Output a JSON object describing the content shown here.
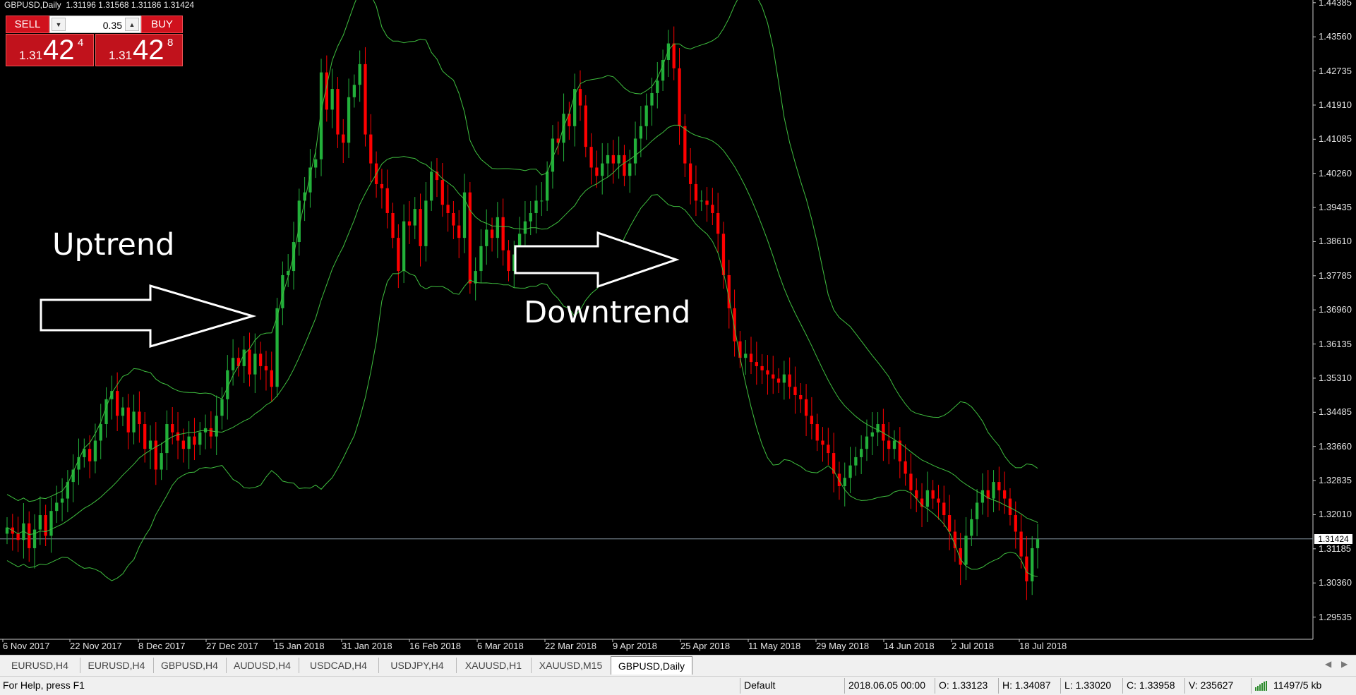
{
  "header": {
    "symbol": "GBPUSD,Daily",
    "ohlc": "1.31196 1.31568 1.31186 1.31424"
  },
  "trade_panel": {
    "sell_label": "SELL",
    "buy_label": "BUY",
    "lot_value": "0.35",
    "sell_price": {
      "prefix": "1.31",
      "big": "42",
      "sup": "4"
    },
    "buy_price": {
      "prefix": "1.31",
      "big": "42",
      "sup": "8"
    }
  },
  "annotations": {
    "uptrend": "Uptrend",
    "downtrend": "Downtrend"
  },
  "price_axis": [
    "1.44385",
    "1.43560",
    "1.42735",
    "1.41910",
    "1.41085",
    "1.40260",
    "1.39435",
    "1.38610",
    "1.37785",
    "1.36960",
    "1.36135",
    "1.35310",
    "1.34485",
    "1.33660",
    "1.32835",
    "1.32010",
    "1.31185",
    "1.30360",
    "1.29535"
  ],
  "last_price": "1.31424",
  "date_axis": [
    "6 Nov 2017",
    "22 Nov 2017",
    "8 Dec 2017",
    "27 Dec 2017",
    "15 Jan 2018",
    "31 Jan 2018",
    "16 Feb 2018",
    "6 Mar 2018",
    "22 Mar 2018",
    "9 Apr 2018",
    "25 Apr 2018",
    "11 May 2018",
    "29 May 2018",
    "14 Jun 2018",
    "2 Jul 2018",
    "18 Jul 2018"
  ],
  "tabs": [
    "EURUSD,H4",
    "EURUSD,H4",
    "GBPUSD,H4",
    "AUDUSD,H4",
    "USDCAD,H4",
    "USDJPY,H4",
    "XAUUSD,H1",
    "XAUUSD,M15",
    "GBPUSD,Daily"
  ],
  "active_tab": 8,
  "status": {
    "help": "For Help, press F1",
    "profile": "Default",
    "datetime": "2018.06.05 00:00",
    "open": "O: 1.33123",
    "high": "H: 1.34087",
    "low": "L: 1.33020",
    "close": "C: 1.33958",
    "volume": "V: 235627",
    "traffic": "11497/5 kb"
  },
  "chart_data": {
    "type": "candlestick",
    "title": "GBPUSD,Daily",
    "ylim": [
      1.2905,
      1.4445
    ],
    "bull_color": "#22b03a",
    "bear_color": "#ff0000",
    "band_color": "#3fbf3f",
    "closes": [
      1.317,
      1.3155,
      1.314,
      1.318,
      1.312,
      1.3165,
      1.32,
      1.315,
      1.321,
      1.323,
      1.324,
      1.328,
      1.331,
      1.334,
      1.336,
      1.333,
      1.338,
      1.342,
      1.348,
      1.35,
      1.344,
      1.346,
      1.34,
      1.345,
      1.342,
      1.336,
      1.338,
      1.331,
      1.335,
      1.342,
      1.34,
      1.338,
      1.336,
      1.339,
      1.337,
      1.34,
      1.341,
      1.339,
      1.344,
      1.348,
      1.355,
      1.358,
      1.356,
      1.36,
      1.354,
      1.359,
      1.356,
      1.355,
      1.351,
      1.37,
      1.378,
      1.379,
      1.386,
      1.396,
      1.398,
      1.404,
      1.406,
      1.427,
      1.418,
      1.423,
      1.412,
      1.41,
      1.421,
      1.424,
      1.429,
      1.412,
      1.405,
      1.4,
      1.399,
      1.393,
      1.387,
      1.379,
      1.391,
      1.39,
      1.394,
      1.385,
      1.396,
      1.403,
      1.401,
      1.395,
      1.393,
      1.39,
      1.387,
      1.398,
      1.376,
      1.379,
      1.385,
      1.389,
      1.387,
      1.392,
      1.384,
      1.379,
      1.383,
      1.388,
      1.391,
      1.393,
      1.396,
      1.396,
      1.403,
      1.411,
      1.41,
      1.417,
      1.414,
      1.423,
      1.419,
      1.409,
      1.404,
      1.402,
      1.405,
      1.407,
      1.405,
      1.407,
      1.402,
      1.405,
      1.411,
      1.414,
      1.419,
      1.422,
      1.425,
      1.43,
      1.434,
      1.428,
      1.414,
      1.405,
      1.4,
      1.396,
      1.396,
      1.395,
      1.393,
      1.388,
      1.378,
      1.37,
      1.362,
      1.358,
      1.359,
      1.357,
      1.356,
      1.355,
      1.354,
      1.353,
      1.352,
      1.354,
      1.351,
      1.349,
      1.348,
      1.344,
      1.342,
      1.338,
      1.337,
      1.335,
      1.33,
      1.327,
      1.329,
      1.332,
      1.334,
      1.336,
      1.339,
      1.34,
      1.342,
      1.338,
      1.336,
      1.338,
      1.333,
      1.33,
      1.326,
      1.324,
      1.322,
      1.326,
      1.324,
      1.323,
      1.32,
      1.316,
      1.312,
      1.308,
      1.315,
      1.319,
      1.323,
      1.326,
      1.324,
      1.328,
      1.326,
      1.324,
      1.32,
      1.316,
      1.31,
      1.304,
      1.312,
      1.3142
    ]
  }
}
